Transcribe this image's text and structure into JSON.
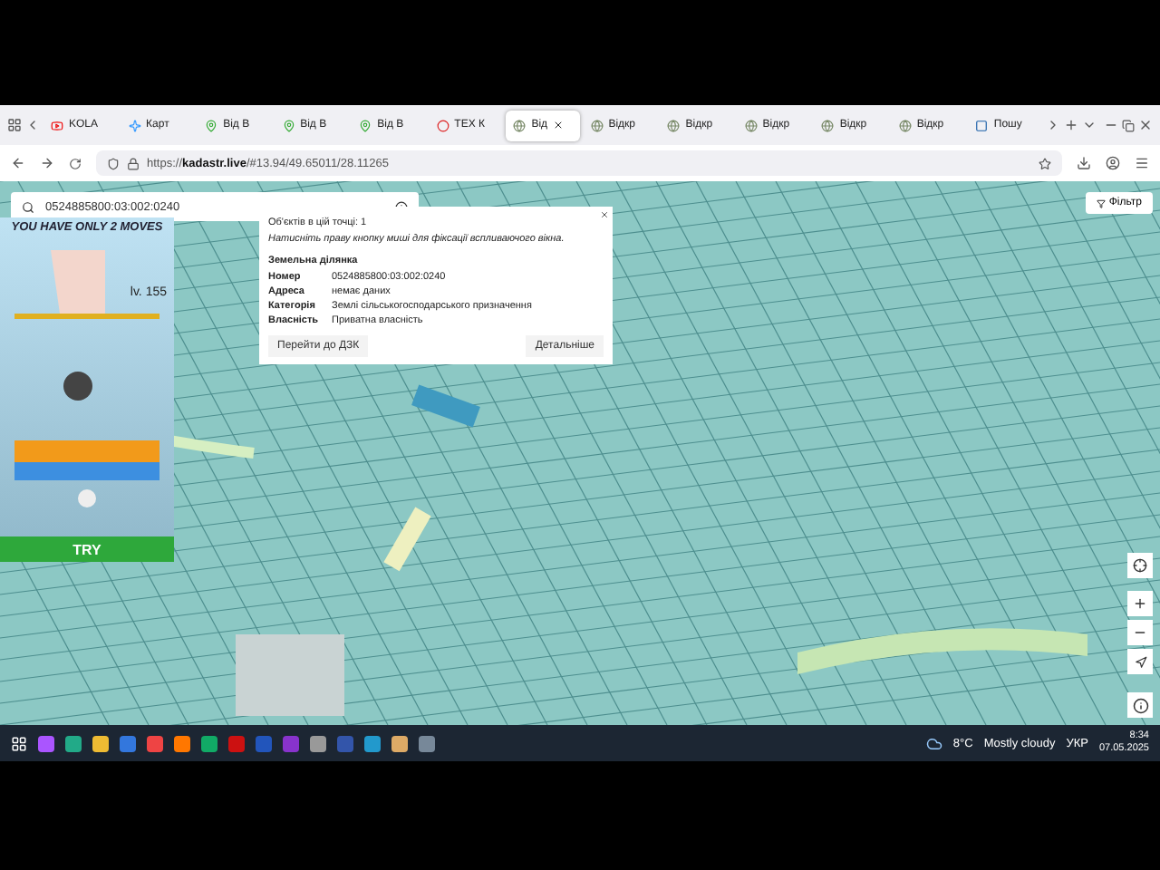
{
  "tabs": [
    {
      "label": "KOLA",
      "selected": false,
      "kind": "video"
    },
    {
      "label": "Карт",
      "selected": false,
      "kind": "spark"
    },
    {
      "label": "Від В",
      "selected": false,
      "kind": "pin"
    },
    {
      "label": "Від В",
      "selected": false,
      "kind": "pin"
    },
    {
      "label": "Від В",
      "selected": false,
      "kind": "pin"
    },
    {
      "label": "TEX К",
      "selected": false,
      "kind": "ring"
    },
    {
      "label": "Від",
      "selected": true,
      "kind": "site"
    },
    {
      "label": "Відкр",
      "selected": false,
      "kind": "site"
    },
    {
      "label": "Відкр",
      "selected": false,
      "kind": "site"
    },
    {
      "label": "Відкр",
      "selected": false,
      "kind": "site"
    },
    {
      "label": "Відкр",
      "selected": false,
      "kind": "site"
    },
    {
      "label": "Відкр",
      "selected": false,
      "kind": "site"
    },
    {
      "label": "Пошу",
      "selected": false,
      "kind": "square"
    }
  ],
  "address": {
    "prefix": "https://",
    "host": "kadastr.live",
    "path": "/#13.94/49.65011/28.11265"
  },
  "search": {
    "value": "0524885800:03:002:0240"
  },
  "filter_button": "Фільтр",
  "popup": {
    "count": "Об'єктів в цій точці: 1",
    "hint": "Натисніть праву кнопку миші для фіксації вспливаючого вікна.",
    "heading": "Земельна ділянка",
    "rows": [
      {
        "label": "Номер",
        "value": "0524885800:03:002:0240"
      },
      {
        "label": "Адреса",
        "value": "немає даних"
      },
      {
        "label": "Категорія",
        "value": "Землі сільськогосподарського призначення"
      },
      {
        "label": "Власність",
        "value": "Приватна власність"
      }
    ],
    "buttons": [
      "Перейти до ДЗК",
      "Детальніше"
    ]
  },
  "ad": {
    "headline": "YOU HAVE ONLY 2 MOVES",
    "level": "lv. 155",
    "cta": "TRY"
  },
  "taskbar": {
    "temperature": "8°C",
    "weather": "Mostly cloudy",
    "language": "УКР",
    "time": "8:34",
    "date": "07.05.2025"
  }
}
